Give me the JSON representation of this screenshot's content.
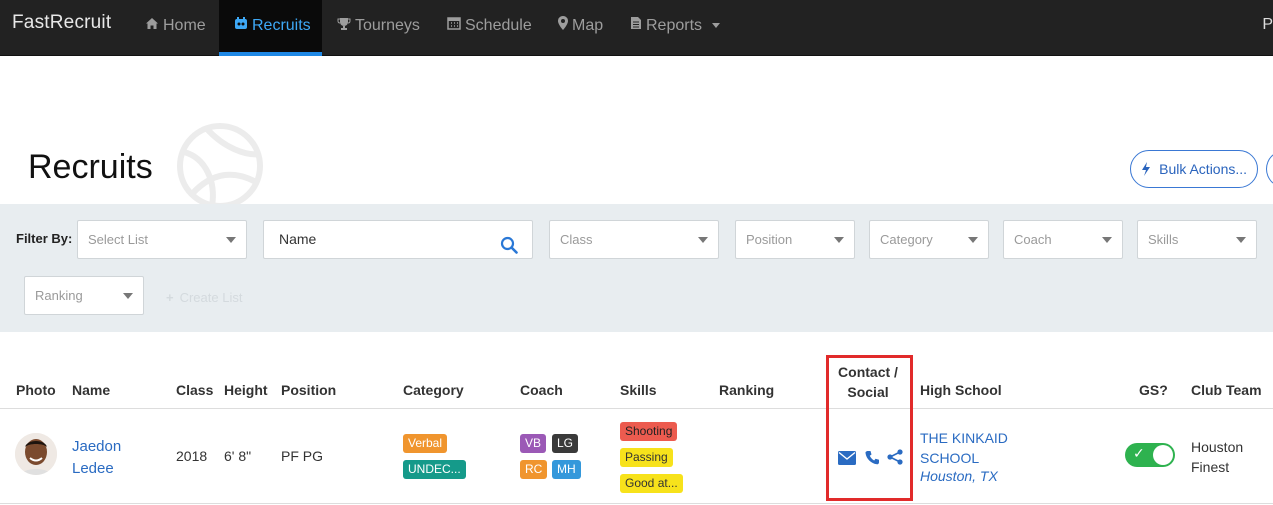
{
  "nav": {
    "brand": "FastRecruit",
    "items": [
      {
        "label": "Home",
        "icon": "home-icon"
      },
      {
        "label": "Recruits",
        "icon": "recruits-icon",
        "active": true
      },
      {
        "label": "Tourneys",
        "icon": "trophy-icon"
      },
      {
        "label": "Schedule",
        "icon": "calendar-icon"
      },
      {
        "label": "Map",
        "icon": "map-marker-icon"
      },
      {
        "label": "Reports",
        "icon": "file-icon"
      }
    ],
    "user_initial": "P"
  },
  "page": {
    "title": "Recruits",
    "bulk_actions_label": "Bulk Actions..."
  },
  "filters": {
    "label": "Filter By:",
    "select_list_placeholder": "Select List",
    "name_placeholder": "Name",
    "class_placeholder": "Class",
    "position_placeholder": "Position",
    "category_placeholder": "Category",
    "coach_placeholder": "Coach",
    "skills_placeholder": "Skills",
    "ranking_placeholder": "Ranking",
    "create_list_label": "Create List"
  },
  "table": {
    "headers": {
      "photo": "Photo",
      "name": "Name",
      "class": "Class",
      "height": "Height",
      "position": "Position",
      "category": "Category",
      "coach": "Coach",
      "skills": "Skills",
      "ranking": "Ranking",
      "contact_line1": "Contact /",
      "contact_line2": "Social",
      "high_school": "High School",
      "gs": "GS?",
      "club_team": "Club Team"
    },
    "rows": [
      {
        "first_name": "Jaedon",
        "last_name": "Ledee",
        "class": "2018",
        "height": "6' 8\"",
        "position": "PF PG",
        "categories": [
          "Verbal",
          "UNDEC..."
        ],
        "coaches": [
          "VB",
          "LG",
          "RC",
          "MH"
        ],
        "skills": [
          "Shooting",
          "Passing",
          "Good at..."
        ],
        "high_school_line1": "THE KINKAID",
        "high_school_line2": "SCHOOL",
        "location": "Houston, TX",
        "gs_enabled": true,
        "club_line1": "Houston",
        "club_line2": "Finest"
      }
    ]
  },
  "colors": {
    "nav_bg": "#222222",
    "accent": "#1e88e5",
    "toggle_on": "#2eb24f",
    "highlight_box": "#e12a2a"
  }
}
